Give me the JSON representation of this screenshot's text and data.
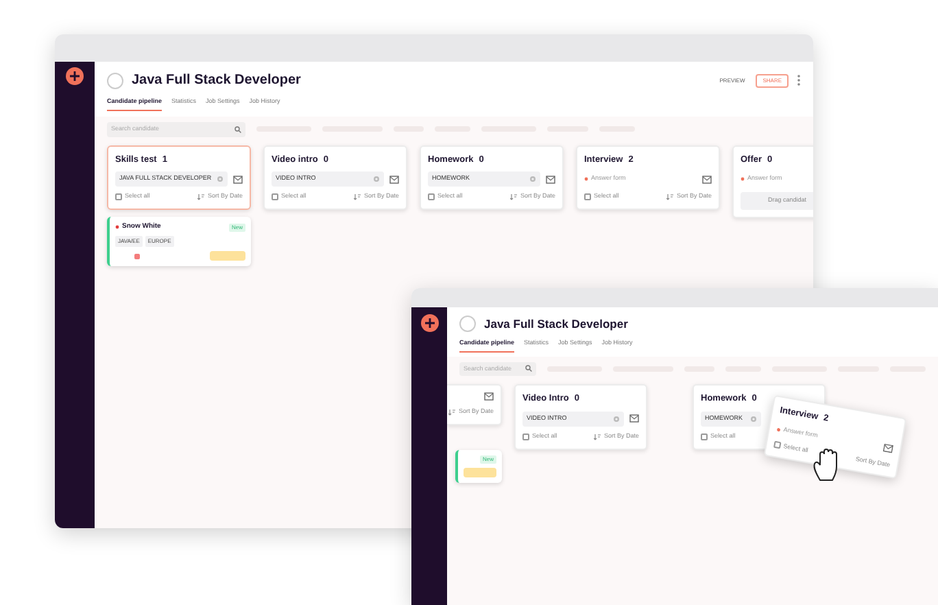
{
  "windows": [
    {
      "kind": "main",
      "job_title": "Java Full Stack Developer",
      "tabs": [
        {
          "label": "Candidate pipeline",
          "selected": true
        },
        {
          "label": "Statistics",
          "selected": false
        },
        {
          "label": "Job Settings",
          "selected": false
        },
        {
          "label": "Job History",
          "selected": false
        }
      ],
      "search": {
        "placeholder": "Search candidate"
      },
      "actions": [
        {
          "kind": "plain",
          "label": "PREVIEW"
        },
        {
          "kind": "outline",
          "label": "SHARE"
        }
      ],
      "columns": [
        {
          "kind": "full",
          "name": "Skills test",
          "count": "1",
          "highlighted": true,
          "filter": {
            "kind": "tag",
            "label": "JAVA FULL STACK DEVELOPER"
          },
          "select_all": "Select all",
          "checked": false,
          "sort": "Sort By Date",
          "candidates": [
            {
              "name": "Snow White",
              "badge": "New",
              "tags": [
                "JAVA/EE",
                "EUROPE"
              ]
            }
          ]
        },
        {
          "kind": "full",
          "name": "Video intro",
          "count": "0",
          "highlighted": false,
          "filter": {
            "kind": "tag",
            "label": "VIDEO INTRO"
          },
          "select_all": "Select all",
          "checked": false,
          "sort": "Sort By Date"
        },
        {
          "kind": "full",
          "name": "Homework",
          "count": "0",
          "highlighted": false,
          "filter": {
            "kind": "tag",
            "label": "HOMEWORK"
          },
          "select_all": "Select all",
          "checked": false,
          "sort": "Sort By Date"
        },
        {
          "kind": "full",
          "name": "Interview",
          "count": "2",
          "highlighted": false,
          "filter": {
            "kind": "note",
            "label": "Answer form"
          },
          "select_all": "Select all",
          "checked": false,
          "sort": "Sort By Date"
        },
        {
          "kind": "drop",
          "name": "Offer",
          "count": "0",
          "highlighted": false,
          "filter": {
            "kind": "note",
            "label": "Answer form"
          },
          "drop_hint": "Drag candidat"
        }
      ]
    },
    {
      "kind": "second",
      "job_title": "Java Full Stack Developer",
      "tabs": [
        {
          "label": "Candidate pipeline",
          "selected": true
        },
        {
          "label": "Statistics",
          "selected": false
        },
        {
          "label": "Job Settings",
          "selected": false
        },
        {
          "label": "Job History",
          "selected": false
        }
      ],
      "search": {
        "placeholder": "Search candidate"
      },
      "columns": [
        {
          "kind": "partial",
          "sort": "Sort By Date",
          "candidates": [
            {
              "badge": "New"
            }
          ]
        },
        {
          "kind": "full",
          "name": "Video Intro",
          "count": "0",
          "highlighted": false,
          "filter": {
            "kind": "tag",
            "label": "VIDEO INTRO"
          },
          "select_all": "Select all",
          "checked": false,
          "sort": "Sort By Date"
        },
        {
          "kind": "covered",
          "name": "Homework",
          "count": "0",
          "highlighted": false,
          "filter": {
            "kind": "tag",
            "label": "HOMEWORK"
          },
          "select_all": "Select all",
          "checked": false
        }
      ],
      "dragged": {
        "name": "Interview",
        "count": "2",
        "note": "Answer form",
        "select_all": "Select all",
        "checked": false,
        "sort": "Sort By Date"
      }
    }
  ]
}
